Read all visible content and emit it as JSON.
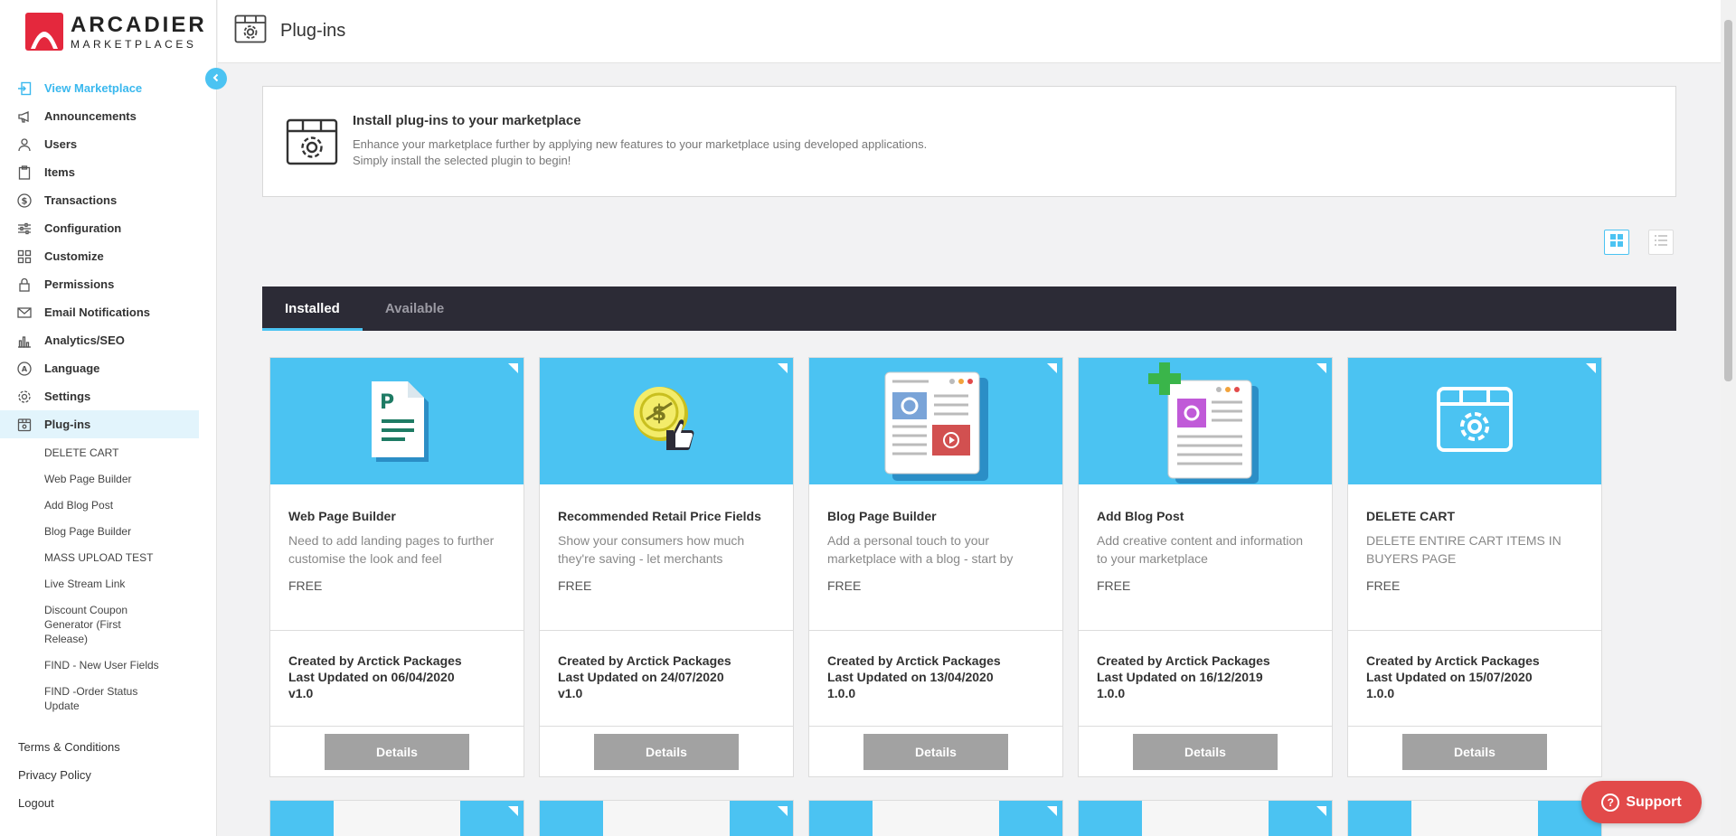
{
  "brand": {
    "line1": "ARCADIER",
    "line2": "MARKETPLACES"
  },
  "header": {
    "title": "Plug-ins"
  },
  "sidebar": {
    "items": [
      {
        "label": "View Marketplace",
        "icon": "view-marketplace-icon"
      },
      {
        "label": "Announcements",
        "icon": "megaphone-icon"
      },
      {
        "label": "Users",
        "icon": "user-icon"
      },
      {
        "label": "Items",
        "icon": "clipboard-icon"
      },
      {
        "label": "Transactions",
        "icon": "dollar-icon"
      },
      {
        "label": "Configuration",
        "icon": "sliders-icon"
      },
      {
        "label": "Customize",
        "icon": "grid-icon"
      },
      {
        "label": "Permissions",
        "icon": "lock-icon"
      },
      {
        "label": "Email Notifications",
        "icon": "envelope-icon"
      },
      {
        "label": "Analytics/SEO",
        "icon": "bar-chart-icon"
      },
      {
        "label": "Language",
        "icon": "language-icon"
      },
      {
        "label": "Settings",
        "icon": "gear-icon"
      },
      {
        "label": "Plug-ins",
        "icon": "plugin-box-icon"
      }
    ],
    "subitems": [
      "DELETE CART",
      "Web Page Builder",
      "Add Blog Post",
      "Blog Page Builder",
      "MASS UPLOAD TEST",
      "Live Stream Link",
      "Discount Coupon Generator (First Release)",
      "FIND - New User Fields",
      "FIND -Order Status Update"
    ],
    "footer": [
      "Terms & Conditions",
      "Privacy Policy",
      "Logout"
    ]
  },
  "intro": {
    "title": "Install plug-ins to your marketplace",
    "line1": "Enhance your marketplace further by applying new features to your marketplace using developed applications.",
    "line2": "Simply install the selected plugin to begin!"
  },
  "tabs": [
    "Installed",
    "Available"
  ],
  "cards": [
    {
      "name": "Web Page Builder",
      "desc": "Need to add landing pages to further customise the look and feel",
      "price": "FREE",
      "creator": "Created by Arctick Packages",
      "updated": "Last Updated on 06/04/2020",
      "version": "v1.0",
      "button": "Details",
      "icon": "document-icon"
    },
    {
      "name": "Recommended Retail Price Fields",
      "desc": "Show your consumers how much they're saving - let merchants",
      "price": "FREE",
      "creator": "Created by Arctick Packages",
      "updated": "Last Updated on 24/07/2020",
      "version": "v1.0",
      "button": "Details",
      "icon": "coin-thumbs-up-icon"
    },
    {
      "name": "Blog Page Builder",
      "desc": "Add a personal touch to your marketplace with a blog - start by",
      "price": "FREE",
      "creator": "Created by Arctick Packages",
      "updated": "Last Updated on 13/04/2020",
      "version": "1.0.0",
      "button": "Details",
      "icon": "blog-page-icon"
    },
    {
      "name": "Add Blog Post",
      "desc": "Add creative content and information to your marketplace",
      "price": "FREE",
      "creator": "Created by Arctick Packages",
      "updated": "Last Updated on 16/12/2019",
      "version": "1.0.0",
      "button": "Details",
      "icon": "add-post-icon"
    },
    {
      "name": "DELETE CART",
      "desc": "DELETE ENTIRE CART ITEMS IN BUYERS PAGE",
      "price": "FREE",
      "creator": "Created by Arctick Packages",
      "updated": "Last Updated on 15/07/2020",
      "version": "1.0.0",
      "button": "Details",
      "icon": "plugin-box-icon"
    }
  ],
  "support": {
    "label": "Support"
  },
  "colors": {
    "accent": "#4bc3f2",
    "brand": "#e4283d",
    "tabbar": "#2c2b36",
    "support": "#e24a4a"
  }
}
